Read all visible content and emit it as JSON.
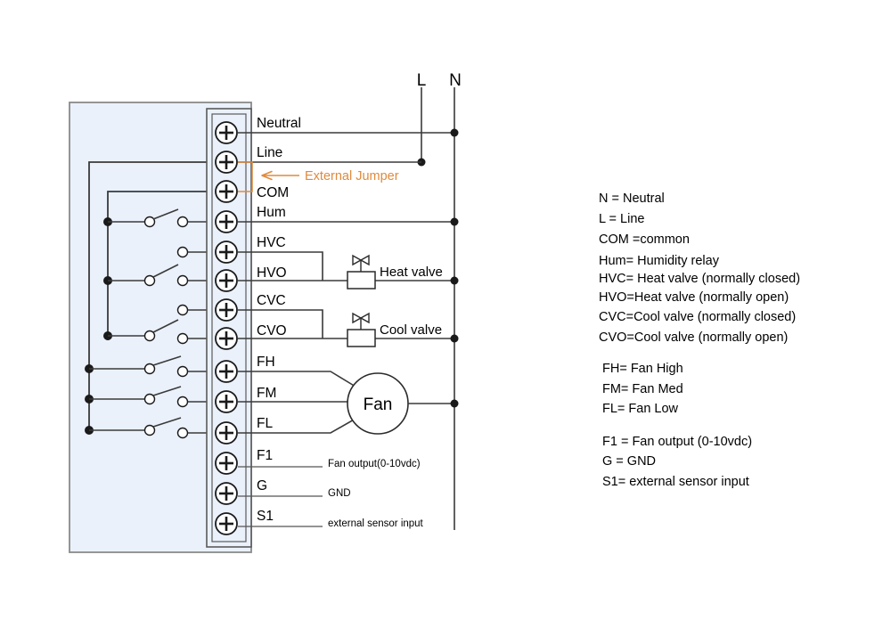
{
  "diagram": {
    "title": "Thermostat terminal wiring diagram",
    "mains": {
      "line_label": "L",
      "neutral_label": "N"
    },
    "annotation": {
      "jumper_label": "External Jumper",
      "jumper_color": "#e08a3c"
    },
    "fan": {
      "label": "Fan"
    },
    "valves": [
      {
        "name": "heat-valve",
        "label": "Heat valve"
      },
      {
        "name": "cool-valve",
        "label": "Cool valve"
      }
    ],
    "terminals": [
      {
        "id": "neutral",
        "label": "Neutral"
      },
      {
        "id": "line",
        "label": "Line"
      },
      {
        "id": "com",
        "label": "COM"
      },
      {
        "id": "hum",
        "label": "Hum"
      },
      {
        "id": "hvc",
        "label": "HVC"
      },
      {
        "id": "hvo",
        "label": "HVO"
      },
      {
        "id": "cvc",
        "label": "CVC"
      },
      {
        "id": "cvo",
        "label": "CVO"
      },
      {
        "id": "fh",
        "label": "FH"
      },
      {
        "id": "fm",
        "label": "FM"
      },
      {
        "id": "fl",
        "label": "FL"
      },
      {
        "id": "f1",
        "label": "F1"
      },
      {
        "id": "g",
        "label": "G"
      },
      {
        "id": "s1",
        "label": "S1"
      }
    ],
    "wire_notes": [
      {
        "id": "f1-note",
        "label": "Fan output(0-10vdc)"
      },
      {
        "id": "g-note",
        "label": "GND"
      },
      {
        "id": "s1-note",
        "label": "external sensor input"
      }
    ],
    "legend": {
      "group_a": [
        "N = Neutral",
        "L = Line",
        "COM =common"
      ],
      "group_b": [
        "Hum= Humidity relay",
        "HVC= Heat valve (normally closed)",
        "HVO=Heat valve (normally open)",
        "CVC=Cool valve (normally closed)",
        "CVO=Cool valve (normally open)"
      ],
      "group_c": [
        "FH= Fan High",
        "FM= Fan Med",
        "FL= Fan Low"
      ],
      "group_d": [
        "F1 = Fan output (0-10vdc)",
        "G = GND",
        "S1= external sensor input"
      ]
    }
  }
}
